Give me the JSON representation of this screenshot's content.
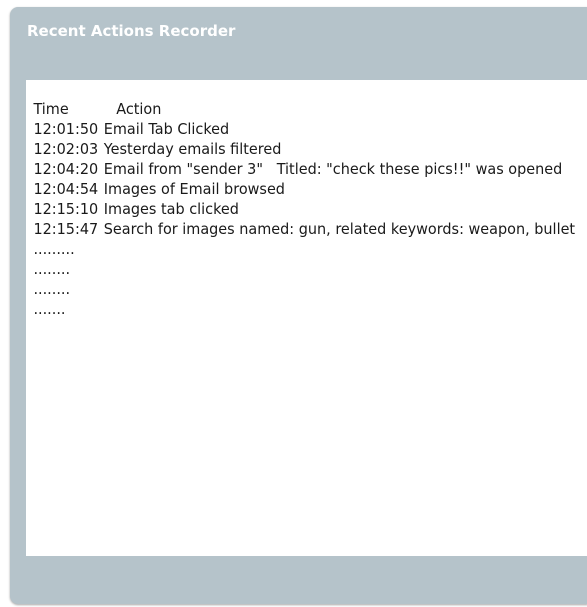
{
  "window": {
    "title": "Recent Actions Recorder"
  },
  "log": {
    "headers": {
      "time": "Time",
      "action": "Action"
    },
    "entries": [
      {
        "time": "12:01:50",
        "action": "Email Tab Clicked"
      },
      {
        "time": "12:02:03",
        "action": "Yesterday emails filtered"
      },
      {
        "time": "12:04:20",
        "action": "Email from \"sender 3\"   Titled: \"check these pics!!\" was opened"
      },
      {
        "time": "12:04:54",
        "action": "Images of Email browsed"
      },
      {
        "time": "12:15:10",
        "action": "Images tab clicked"
      },
      {
        "time": "12:15:47",
        "action": "Search for images named: gun, related keywords: weapon, bullet"
      }
    ],
    "continuation": [
      ".........",
      "........",
      "........",
      "......."
    ]
  },
  "colors": {
    "panel_background": "#b5c3ca",
    "title_text": "#ffffff",
    "log_background": "#ffffff",
    "log_text": "#1a1a1a"
  }
}
